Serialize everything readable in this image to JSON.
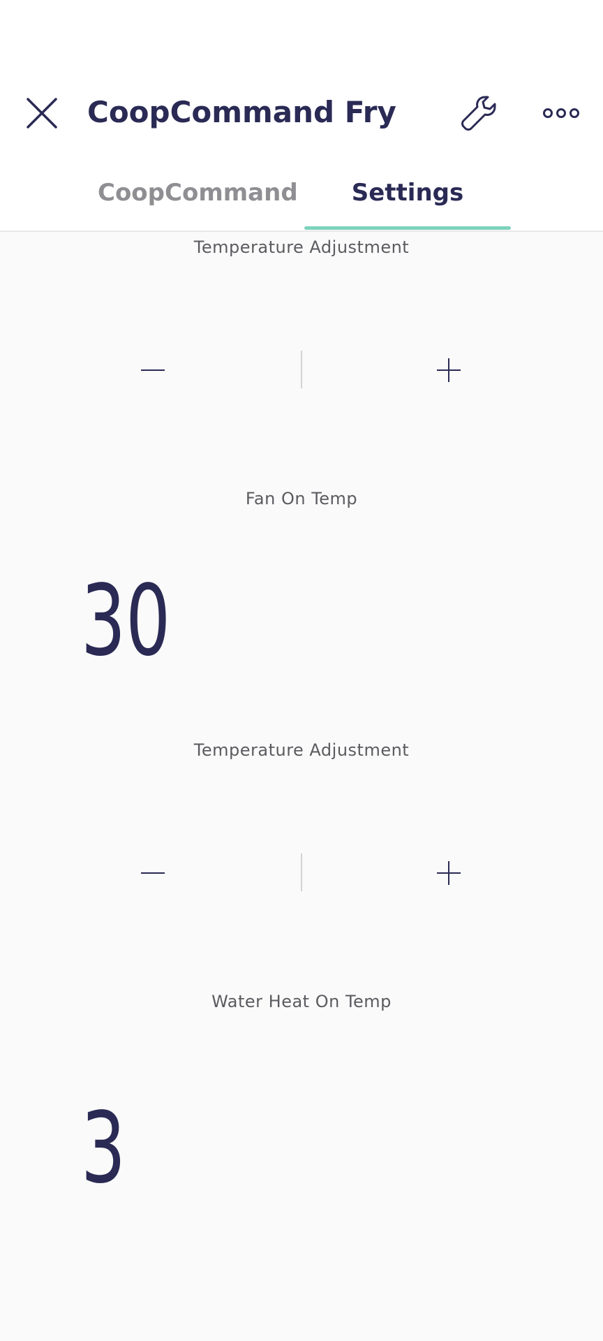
{
  "header": {
    "title": "CoopCommand Fry",
    "close_icon": "close-icon",
    "wrench_icon": "wrench-icon",
    "more_icon": "more-icon"
  },
  "tabs": [
    {
      "label": "CoopCommand",
      "active": false
    },
    {
      "label": "Settings",
      "active": true
    }
  ],
  "accent_color": "#7ed3bc",
  "settings": [
    {
      "adjust_label": "Temperature Adjustment",
      "decrement_icon": "minus-icon",
      "increment_icon": "plus-icon",
      "value_label": "Fan On Temp",
      "value": "30"
    },
    {
      "adjust_label": "Temperature Adjustment",
      "decrement_icon": "minus-icon",
      "increment_icon": "plus-icon",
      "value_label": "Water Heat On Temp",
      "value": "3"
    }
  ]
}
